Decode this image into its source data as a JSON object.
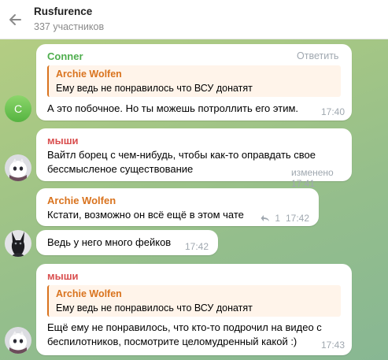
{
  "header": {
    "title": "Rusfurence",
    "subtitle": "337 участников"
  },
  "messages": [
    {
      "sender": "Conner",
      "sender_color": "#4fae4e",
      "avatar_letter": "C",
      "reply_label": "Ответить",
      "quote_author": "Archie Wolfen",
      "quote_text": "Ему ведь не понравилось что ВСУ донатят",
      "text": "А это побочное. Но ты можешь потроллить его этим.",
      "time": "17:40"
    },
    {
      "sender": "мыши",
      "sender_color": "#d94f4f",
      "text_line1": "Вайтл борец с чем-нибудь, чтобы как-то оправдать свое",
      "text_line2": "бессмысленое существование",
      "time": "изменено 17:41"
    },
    {
      "sender": "Archie Wolfen",
      "sender_color": "#d9731e",
      "text": "Кстати, возможно он всё ещё в этом чате",
      "reply_count": "1",
      "time": "17:42"
    },
    {
      "text": "Ведь у него много фейков",
      "time": "17:42"
    },
    {
      "sender": "мыши",
      "sender_color": "#d94f4f",
      "quote_author": "Archie Wolfen",
      "quote_text": "Ему ведь не понравилось что ВСУ донатят",
      "text_line1": "Ещё ему не понравилось, что кто-то подрочил на видео с",
      "text_line2": "беспилотников, посмотрите целомудренный какой :)",
      "time": "17:43"
    }
  ]
}
